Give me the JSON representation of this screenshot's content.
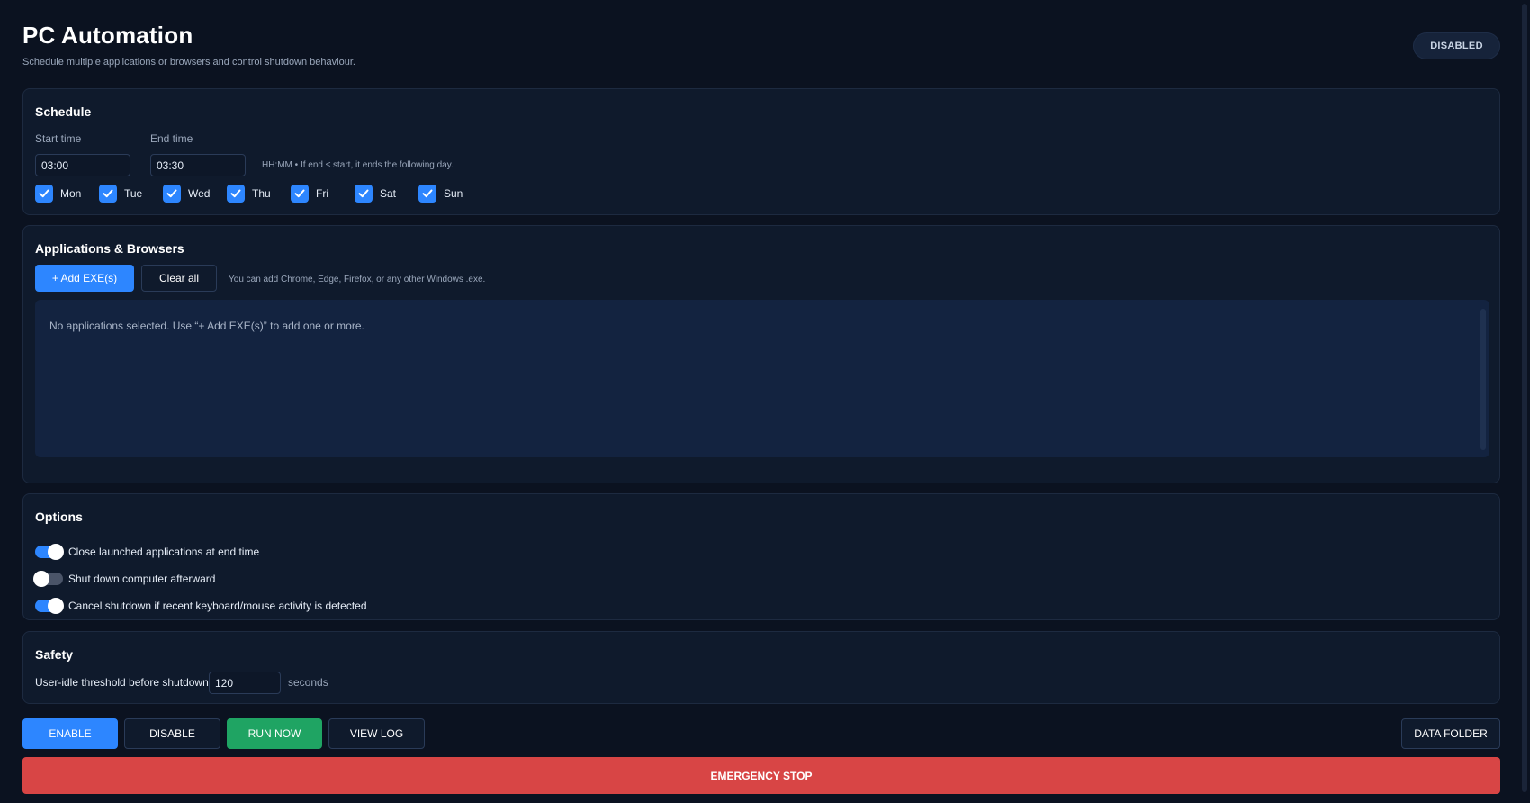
{
  "header": {
    "title": "PC Automation",
    "subtitle": "Schedule multiple applications or browsers and control shutdown behaviour.",
    "status": "DISABLED"
  },
  "schedule": {
    "title": "Schedule",
    "start_label": "Start time",
    "start_value": "03:00",
    "end_label": "End time",
    "end_value": "03:30",
    "hint": "HH:MM • If end ≤ start, it ends the following day.",
    "days": [
      {
        "label": "Mon",
        "checked": true
      },
      {
        "label": "Tue",
        "checked": true
      },
      {
        "label": "Wed",
        "checked": true
      },
      {
        "label": "Thu",
        "checked": true
      },
      {
        "label": "Fri",
        "checked": true
      },
      {
        "label": "Sat",
        "checked": true
      },
      {
        "label": "Sun",
        "checked": true
      }
    ]
  },
  "apps": {
    "title": "Applications & Browsers",
    "add_label": "+ Add EXE(s)",
    "clear_label": "Clear all",
    "hint": "You can add Chrome, Edge, Firefox, or any other Windows .exe.",
    "empty_message": "No applications selected. Use “+ Add EXE(s)” to add one or more."
  },
  "options": {
    "title": "Options",
    "items": [
      {
        "label": "Close launched applications at end time",
        "on": true
      },
      {
        "label": "Shut down computer afterward",
        "on": false
      },
      {
        "label": "Cancel shutdown if recent keyboard/mouse activity is detected",
        "on": true
      }
    ]
  },
  "safety": {
    "title": "Safety",
    "idle_label": "User-idle threshold before shutdown",
    "idle_value": "120",
    "idle_unit": "seconds"
  },
  "actions": {
    "enable": "ENABLE",
    "disable": "DISABLE",
    "run_now": "RUN NOW",
    "view_log": "VIEW LOG",
    "data_folder": "DATA FOLDER",
    "emergency_stop": "EMERGENCY STOP"
  },
  "colors": {
    "background": "#0b1220",
    "panel": "#0f1a2c",
    "accent_blue": "#2d86ff",
    "accent_green": "#1fa463",
    "accent_red": "#d84545"
  }
}
